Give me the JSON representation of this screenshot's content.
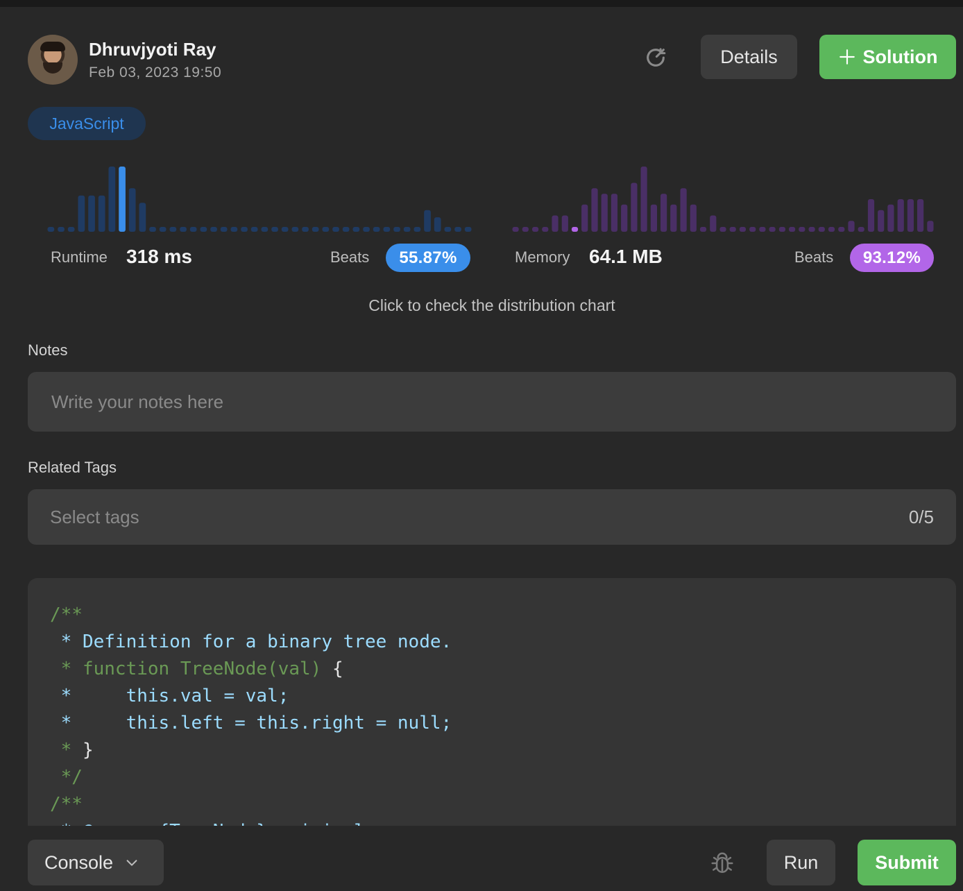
{
  "header": {
    "user_name": "Dhruvjyoti Ray",
    "date": "Feb 03, 2023 19:50",
    "details_label": "Details",
    "solution_label": "Solution"
  },
  "language": "JavaScript",
  "runtime": {
    "label": "Runtime",
    "value": "318 ms",
    "beats_label": "Beats",
    "beats_value": "55.87%",
    "color": "#1f3b63",
    "highlight_color": "#3a8eea",
    "pill_color": "#3a8eea",
    "highlight_index": 7,
    "distribution": [
      1,
      1,
      1,
      5,
      5,
      5,
      9,
      9,
      6,
      4,
      1,
      1,
      1,
      1,
      1,
      1,
      1,
      1,
      1,
      1,
      1,
      1,
      1,
      1,
      1,
      1,
      1,
      1,
      1,
      1,
      1,
      1,
      1,
      1,
      1,
      1,
      1,
      3,
      2,
      1,
      1,
      1
    ]
  },
  "memory": {
    "label": "Memory",
    "value": "64.1 MB",
    "beats_label": "Beats",
    "beats_value": "93.12%",
    "color": "#4a2f66",
    "highlight_color": "#b266e8",
    "pill_color": "#b266e8",
    "highlight_index": 6,
    "distribution": [
      1,
      1,
      1,
      1,
      3,
      3,
      1,
      5,
      8,
      7,
      7,
      5,
      9,
      12,
      5,
      7,
      5,
      8,
      5,
      1,
      3,
      1,
      1,
      1,
      1,
      1,
      1,
      1,
      1,
      1,
      1,
      1,
      1,
      1,
      2,
      1,
      6,
      4,
      5,
      6,
      6,
      6,
      2
    ]
  },
  "distribution_link": "Click to check the distribution chart",
  "notes": {
    "label": "Notes",
    "placeholder": "Write your notes here"
  },
  "tags": {
    "label": "Related Tags",
    "placeholder": "Select tags",
    "count": "0/5"
  },
  "code_lines": [
    [
      {
        "t": "/**",
        "c": "green"
      }
    ],
    [
      {
        "t": " * Definition for a binary tree node.",
        "c": "blue"
      }
    ],
    [
      {
        "t": " * function TreeNode(val) ",
        "c": "green"
      },
      {
        "t": "{",
        "c": "white"
      }
    ],
    [
      {
        "t": " *     this.val = val;",
        "c": "blue"
      }
    ],
    [
      {
        "t": " *     this.left = this.right = null;",
        "c": "blue"
      }
    ],
    [
      {
        "t": " * ",
        "c": "green"
      },
      {
        "t": "}",
        "c": "white"
      }
    ],
    [
      {
        "t": " */",
        "c": "green"
      }
    ],
    [
      {
        "t": "/**",
        "c": "green"
      }
    ],
    [
      {
        "t": " * @param {TreeNode} original",
        "c": "blue"
      }
    ]
  ],
  "bottom": {
    "console_label": "Console",
    "run_label": "Run",
    "submit_label": "Submit"
  },
  "icons": {
    "refresh": "refresh-icon",
    "plus": "plus-icon",
    "chevron": "chevron-down-icon",
    "bug": "bug-icon"
  }
}
